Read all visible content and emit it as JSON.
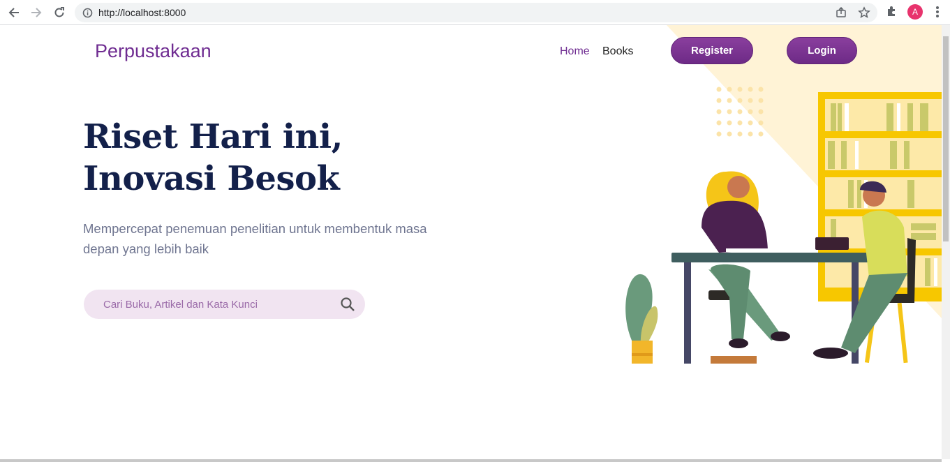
{
  "browser": {
    "url": "http://localhost:8000",
    "profile_initial": "A",
    "icons": [
      "back-icon",
      "forward-icon",
      "reload-icon",
      "info-icon",
      "share-icon",
      "star-icon",
      "extensions-icon",
      "menu-icon"
    ]
  },
  "navbar": {
    "brand": "Perpustakaan",
    "links": [
      "Home",
      "Books"
    ],
    "register_label": "Register",
    "login_label": "Login"
  },
  "hero": {
    "title_line1": "Riset Hari ini,",
    "title_line2": "Inovasi Besok",
    "subtitle": "Mempercepat penemuan penelitian untuk membentuk masa depan yang lebih baik"
  },
  "search": {
    "placeholder": "Cari Buku, Artikel dan Kata Kunci"
  },
  "colors": {
    "brand": "#6f2c91",
    "title": "#13204a",
    "accent_yellow": "#f5c518",
    "search_bg": "#f1e4f1"
  }
}
